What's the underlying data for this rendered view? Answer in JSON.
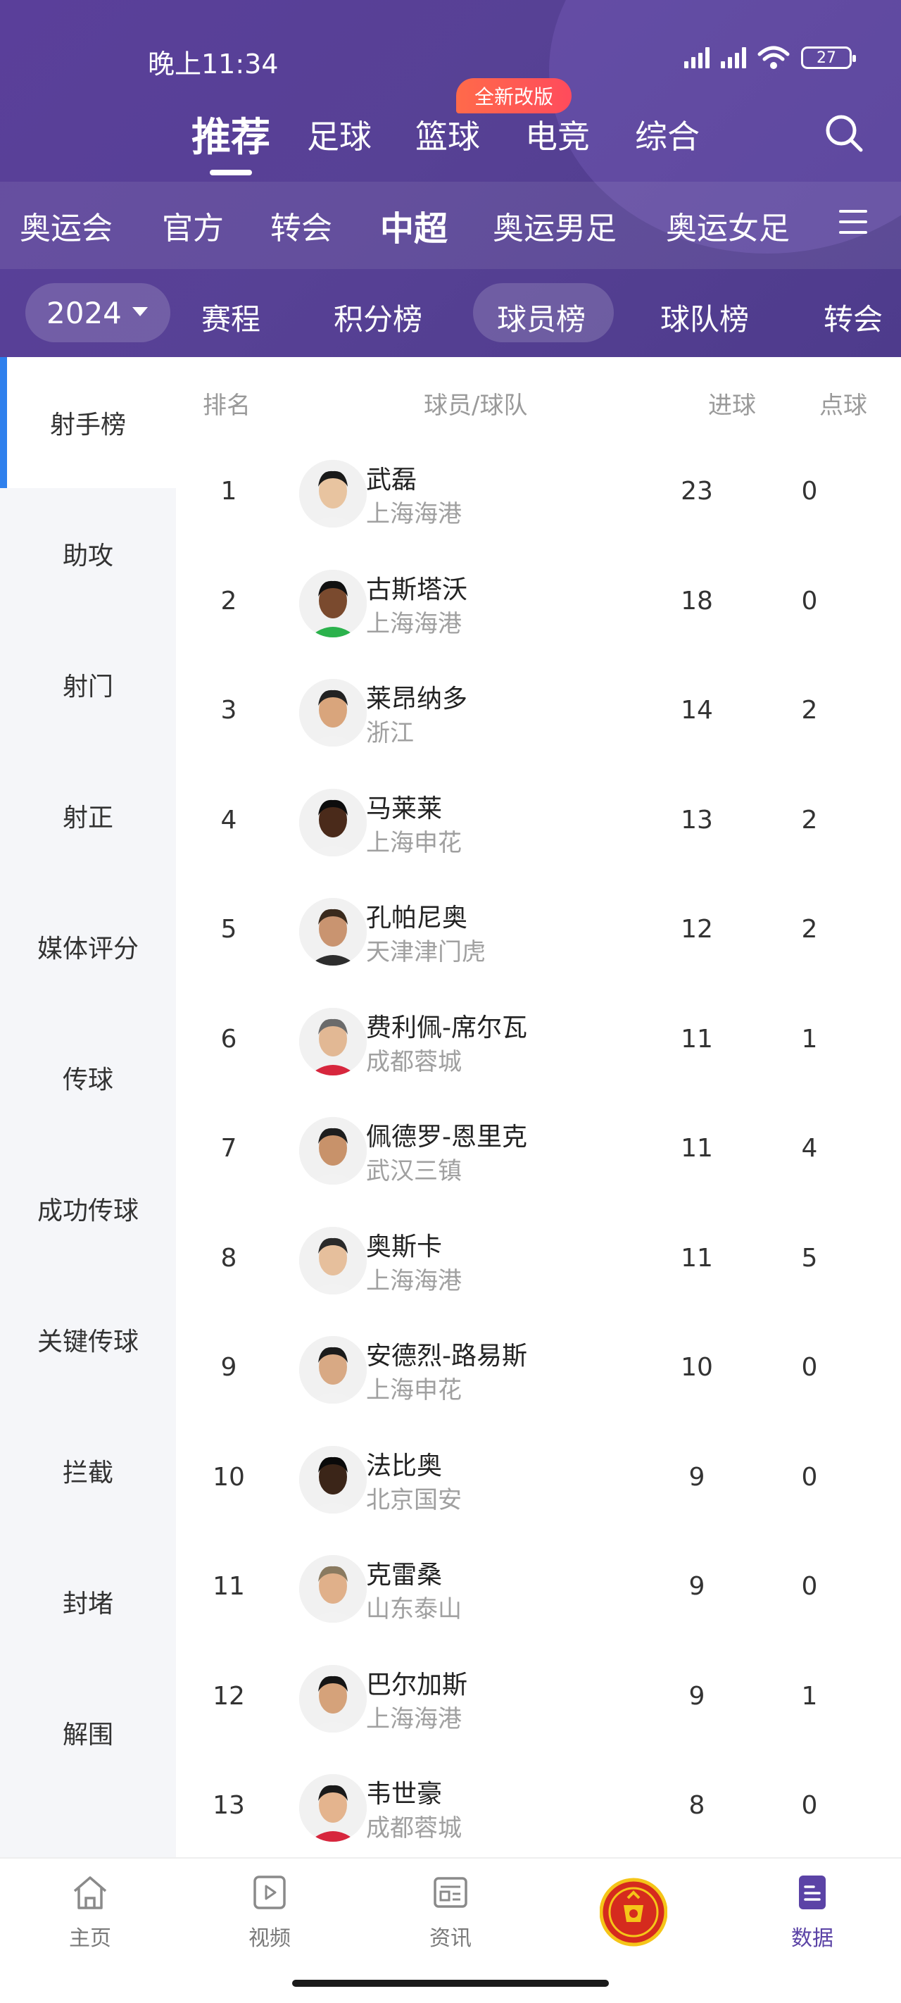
{
  "status_bar": {
    "time": "晚上11:34",
    "battery": "27"
  },
  "main_tabs": [
    {
      "label": "推荐",
      "active": true
    },
    {
      "label": "足球",
      "active": false
    },
    {
      "label": "篮球",
      "active": false
    },
    {
      "label": "电竞",
      "active": false
    },
    {
      "label": "综合",
      "active": false
    }
  ],
  "new_badge": "全新改版",
  "competitions": [
    {
      "label": "奥运会",
      "active": false
    },
    {
      "label": "官方",
      "active": false
    },
    {
      "label": "转会",
      "active": false
    },
    {
      "label": "中超",
      "active": true
    },
    {
      "label": "奥运男足",
      "active": false
    },
    {
      "label": "奥运女足",
      "active": false
    }
  ],
  "season": "2024",
  "sub_tabs": [
    {
      "label": "赛程",
      "active": false
    },
    {
      "label": "积分榜",
      "active": false
    },
    {
      "label": "球员榜",
      "active": true
    },
    {
      "label": "球队榜",
      "active": false
    },
    {
      "label": "转会",
      "active": false
    }
  ],
  "categories": [
    {
      "label": "射手榜",
      "active": true
    },
    {
      "label": "助攻",
      "active": false
    },
    {
      "label": "射门",
      "active": false
    },
    {
      "label": "射正",
      "active": false
    },
    {
      "label": "媒体评分",
      "active": false
    },
    {
      "label": "传球",
      "active": false
    },
    {
      "label": "成功传球",
      "active": false
    },
    {
      "label": "关键传球",
      "active": false
    },
    {
      "label": "拦截",
      "active": false
    },
    {
      "label": "封堵",
      "active": false
    },
    {
      "label": "解围",
      "active": false
    }
  ],
  "table": {
    "headers": {
      "rank": "排名",
      "player_team": "球员/球队",
      "goals": "进球",
      "penalties": "点球"
    },
    "rows": [
      {
        "rank": "1",
        "player": "武磊",
        "team": "上海海港",
        "goals": "23",
        "penalties": "0"
      },
      {
        "rank": "2",
        "player": "古斯塔沃",
        "team": "上海海港",
        "goals": "18",
        "penalties": "0"
      },
      {
        "rank": "3",
        "player": "莱昂纳多",
        "team": "浙江",
        "goals": "14",
        "penalties": "2"
      },
      {
        "rank": "4",
        "player": "马莱莱",
        "team": "上海申花",
        "goals": "13",
        "penalties": "2"
      },
      {
        "rank": "5",
        "player": "孔帕尼奥",
        "team": "天津津门虎",
        "goals": "12",
        "penalties": "2"
      },
      {
        "rank": "6",
        "player": "费利佩-席尔瓦",
        "team": "成都蓉城",
        "goals": "11",
        "penalties": "1"
      },
      {
        "rank": "7",
        "player": "佩德罗-恩里克",
        "team": "武汉三镇",
        "goals": "11",
        "penalties": "4"
      },
      {
        "rank": "8",
        "player": "奥斯卡",
        "team": "上海海港",
        "goals": "11",
        "penalties": "5"
      },
      {
        "rank": "9",
        "player": "安德烈-路易斯",
        "team": "上海申花",
        "goals": "10",
        "penalties": "0"
      },
      {
        "rank": "10",
        "player": "法比奥",
        "team": "北京国安",
        "goals": "9",
        "penalties": "0"
      },
      {
        "rank": "11",
        "player": "克雷桑",
        "team": "山东泰山",
        "goals": "9",
        "penalties": "0"
      },
      {
        "rank": "12",
        "player": "巴尔加斯",
        "team": "上海海港",
        "goals": "9",
        "penalties": "1"
      },
      {
        "rank": "13",
        "player": "韦世豪",
        "team": "成都蓉城",
        "goals": "8",
        "penalties": "0"
      }
    ]
  },
  "bottom_nav": [
    {
      "label": "主页",
      "icon": "home-icon",
      "active": false
    },
    {
      "label": "视频",
      "icon": "video-icon",
      "active": false
    },
    {
      "label": "资讯",
      "icon": "news-icon",
      "active": false
    },
    {
      "label": "",
      "icon": "club-crest-icon",
      "active": false
    },
    {
      "label": "数据",
      "icon": "data-icon",
      "active": true
    }
  ],
  "colors": {
    "header_purple": "#574195",
    "accent_blue": "#2f80ed",
    "active_nav_purple": "#5b43a6",
    "badge_red": "#ff5552",
    "crest_red": "#d52b1e",
    "crest_yellow": "#f5c518"
  }
}
